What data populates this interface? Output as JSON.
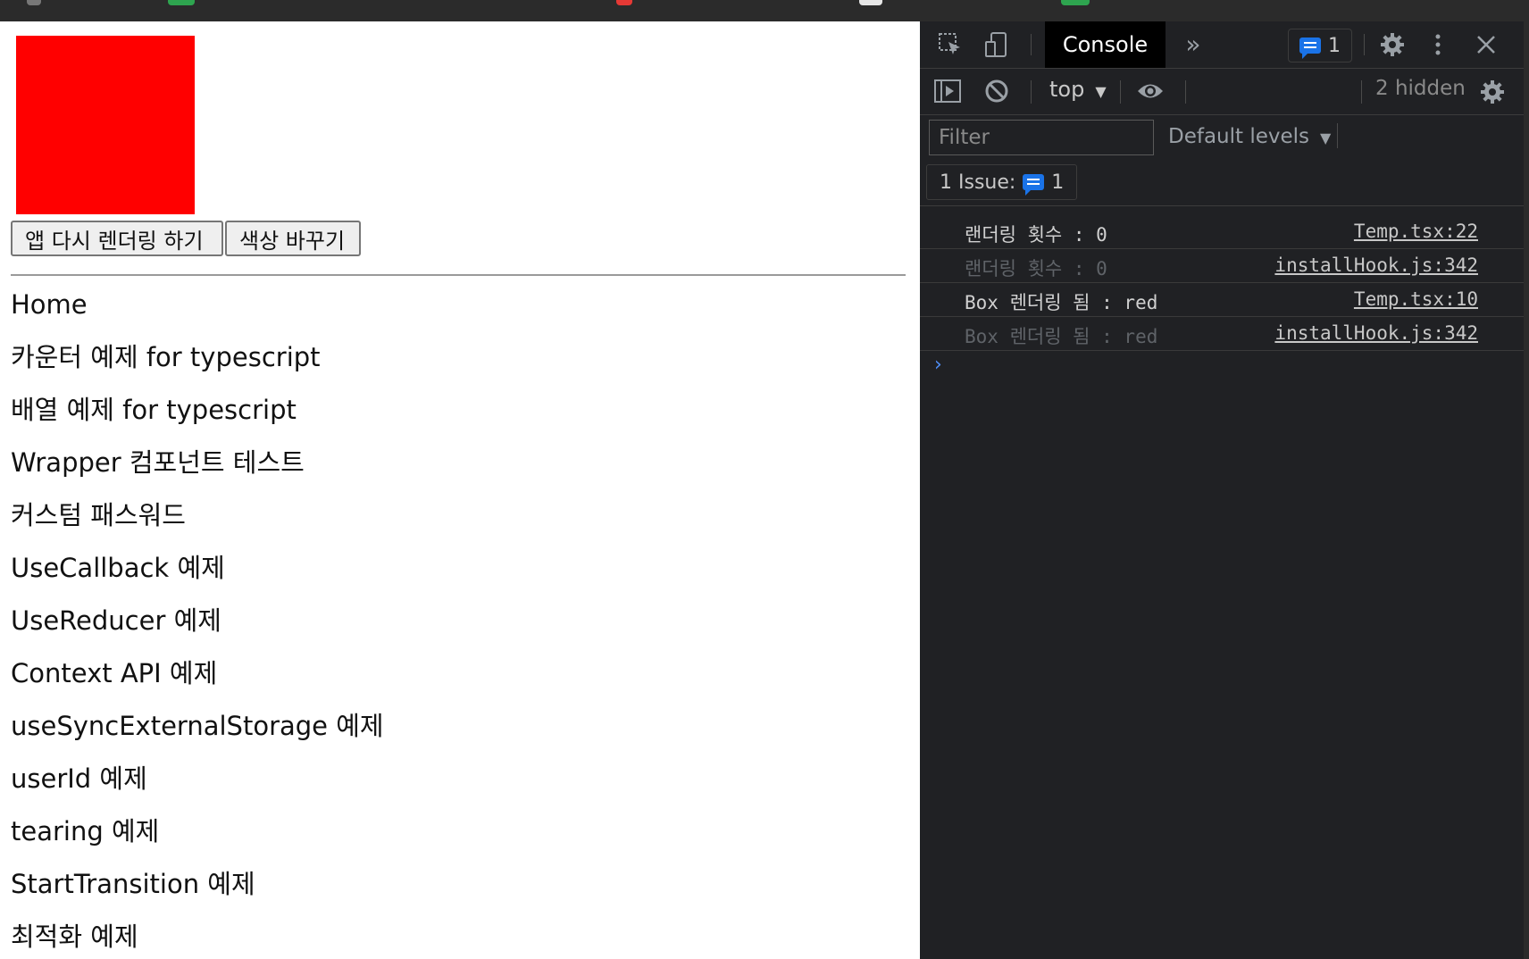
{
  "app": {
    "box_color": "#ff0000",
    "buttons": {
      "rerender": "앱 다시 렌더링 하기",
      "change_color": "색상 바꾸기"
    },
    "nav": [
      "Home",
      "카운터 예제 for typescript",
      "배열 예제 for typescript",
      "Wrapper 컴포넌트 테스트",
      "커스텀 패스워드",
      "UseCallback 예제",
      "UseReducer 예제",
      "Context API 예제",
      "useSyncExternalStorage 예제",
      "userId 예제",
      "tearing 예제",
      "StartTransition 예제",
      "최적화 예제"
    ]
  },
  "devtools": {
    "tab": "Console",
    "issue_badge_count": "1",
    "context": "top",
    "hidden": "2 hidden",
    "filter_placeholder": "Filter",
    "levels": "Default levels",
    "issues_label": "1 Issue:",
    "issues_count": "1",
    "logs": [
      {
        "msg": "랜더링 횟수 : 0",
        "src": "Temp.tsx:22",
        "dim": false
      },
      {
        "msg": "랜더링 횟수 : 0",
        "src": "installHook.js:342",
        "dim": true
      },
      {
        "msg": "Box 렌더링 됨 : red",
        "src": "Temp.tsx:10",
        "dim": false
      },
      {
        "msg": "Box 렌더링 됨 : red",
        "src": "installHook.js:342",
        "dim": true
      }
    ],
    "prompt": "›"
  }
}
